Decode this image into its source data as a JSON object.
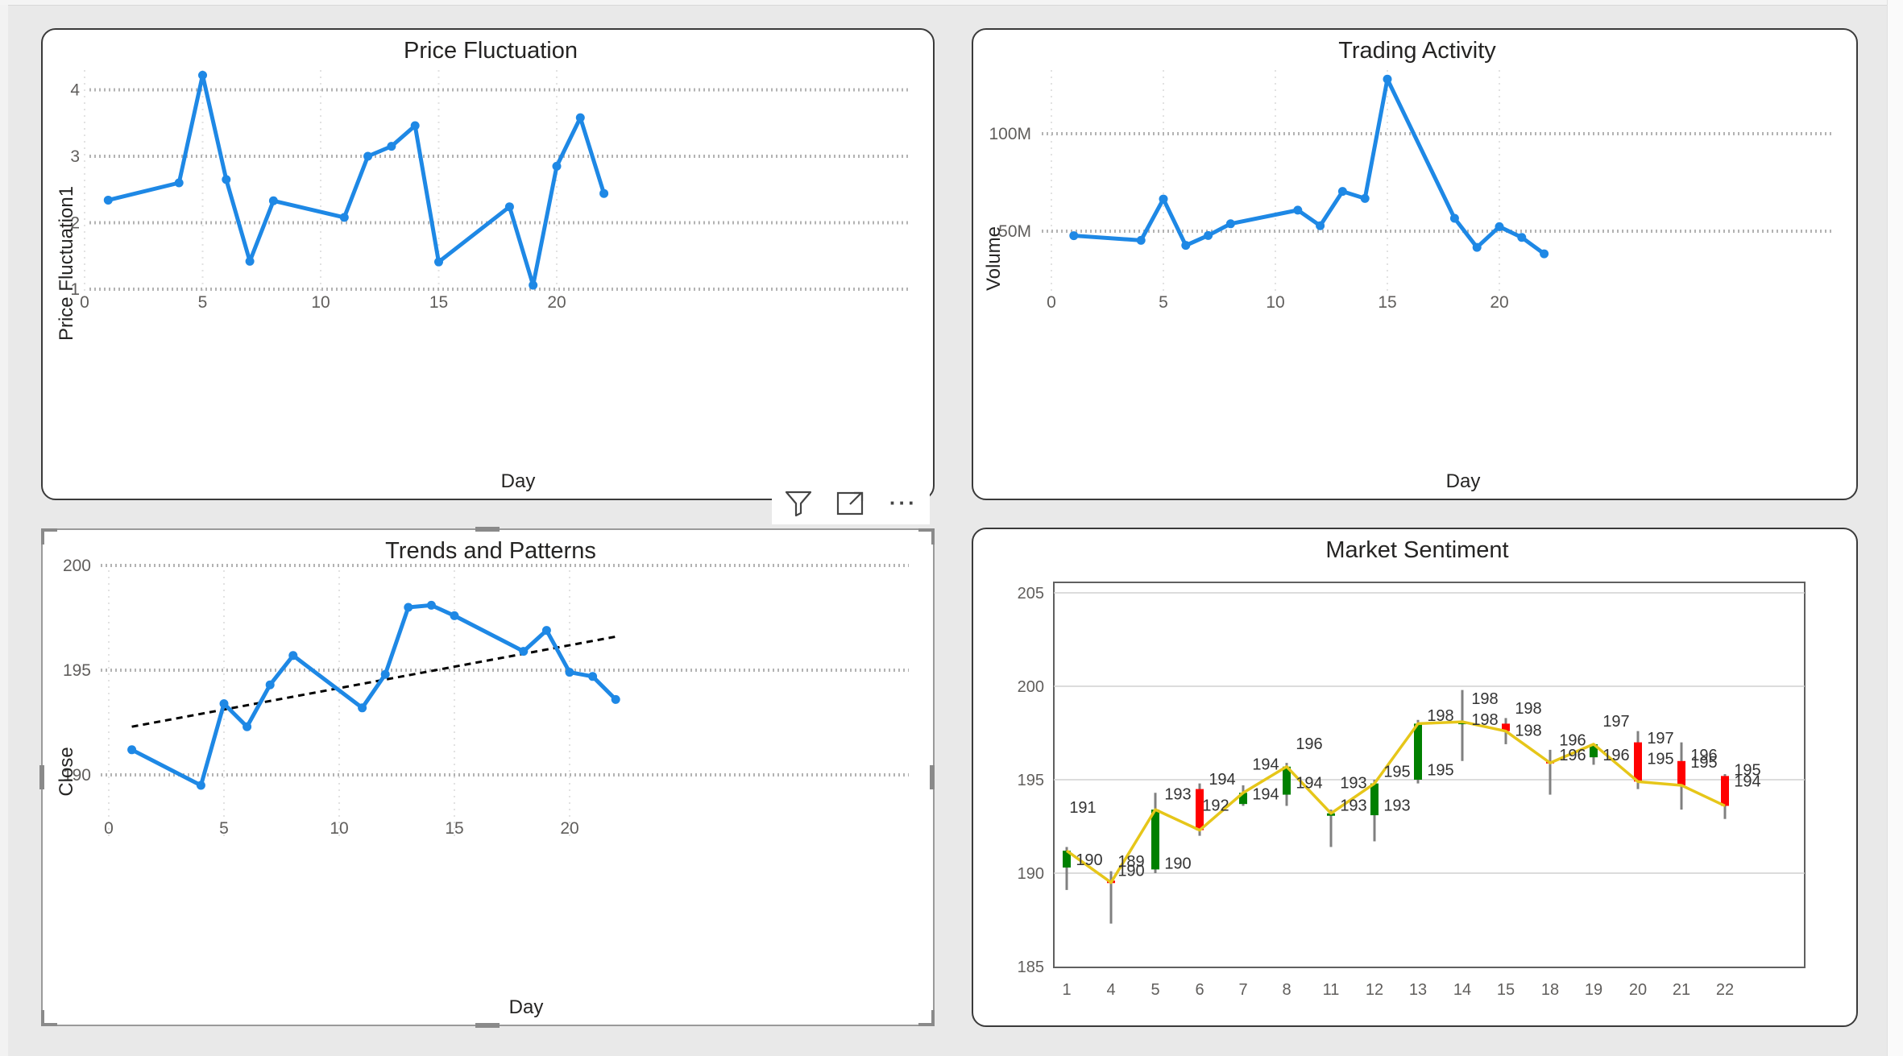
{
  "toolbar": {
    "filter_icon": "filter-icon",
    "focus_icon": "focus-mode-icon",
    "more_icon": "more-options-icon",
    "more_label": "···"
  },
  "colors": {
    "line": "#1e88e5",
    "trend": "#000000",
    "bull": "#008000",
    "bear": "#ff0000",
    "close_line": "#e6c619",
    "wick": "#808080"
  },
  "chart_data": [
    {
      "type": "line",
      "title": "Price Fluctuation",
      "xlabel": "Day",
      "ylabel": "Price Fluctuation1",
      "xlim": [
        0,
        22.3
      ],
      "ylim": [
        1,
        4.6
      ],
      "xticks": [
        "0",
        "5",
        "10",
        "15",
        "20"
      ],
      "yticks": [
        "1",
        "2",
        "3",
        "4"
      ],
      "x": [
        1,
        4,
        5,
        6,
        7,
        8,
        11,
        12,
        13,
        14,
        15,
        18,
        19,
        20,
        21,
        22
      ],
      "y": [
        2.34,
        2.6,
        4.22,
        2.65,
        1.42,
        2.33,
        2.08,
        3.0,
        3.15,
        3.46,
        1.41,
        2.24,
        1.06,
        2.85,
        3.58,
        2.44
      ],
      "grid": true
    },
    {
      "type": "line",
      "title": "Trading Activity",
      "xlabel": "Day",
      "ylabel": "Volume",
      "xlim": [
        0,
        22.3
      ],
      "ylim": [
        30000000,
        142000000
      ],
      "xticks": [
        "0",
        "5",
        "10",
        "15",
        "20"
      ],
      "yticks": [
        "50M",
        "100M"
      ],
      "x": [
        1,
        4,
        5,
        6,
        7,
        8,
        11,
        12,
        13,
        14,
        15,
        18,
        19,
        20,
        21,
        22
      ],
      "y": [
        47700000,
        45300000,
        66500000,
        42700000,
        47800000,
        53800000,
        60800000,
        52800000,
        70400000,
        66800000,
        128000000,
        56600000,
        41700000,
        52300000,
        46800000,
        38400000
      ],
      "grid": true
    },
    {
      "type": "line",
      "title": "Trends and Patterns",
      "xlabel": "Day",
      "ylabel": "Close",
      "xlim": [
        0,
        22.3
      ],
      "ylim": [
        188,
        200
      ],
      "xticks": [
        "0",
        "5",
        "10",
        "15",
        "20"
      ],
      "yticks": [
        "190",
        "195",
        "200"
      ],
      "x": [
        1,
        4,
        5,
        6,
        7,
        8,
        11,
        12,
        13,
        14,
        15,
        18,
        19,
        20,
        21,
        22
      ],
      "y": [
        191.2,
        189.5,
        193.4,
        192.3,
        194.3,
        195.7,
        193.2,
        194.8,
        198.0,
        198.1,
        197.6,
        195.9,
        196.9,
        194.9,
        194.7,
        193.6
      ],
      "trendline": {
        "x": [
          1,
          22
        ],
        "y": [
          192.3,
          196.6
        ],
        "style": "dashed"
      },
      "grid": true
    },
    {
      "type": "candlestick",
      "title": "Market Sentiment",
      "ylim": [
        185,
        205
      ],
      "yticks": [
        "185",
        "190",
        "195",
        "200",
        "205"
      ],
      "categories": [
        "1",
        "4",
        "5",
        "6",
        "7",
        "8",
        "11",
        "12",
        "13",
        "14",
        "15",
        "18",
        "19",
        "20",
        "21",
        "22"
      ],
      "open": [
        190.3,
        189.6,
        190.2,
        194.5,
        193.7,
        194.2,
        193.2,
        193.1,
        195.0,
        198.0,
        198.0,
        196.0,
        196.2,
        197.0,
        196.0,
        195.2
      ],
      "high": [
        191.4,
        190.1,
        194.3,
        194.8,
        194.7,
        195.9,
        193.4,
        195.0,
        198.2,
        199.8,
        198.3,
        196.6,
        196.9,
        197.6,
        197.0,
        195.3
      ],
      "low": [
        189.1,
        187.3,
        190.0,
        192.0,
        193.6,
        193.6,
        191.4,
        191.7,
        194.8,
        196.0,
        196.9,
        194.2,
        195.8,
        194.5,
        193.4,
        192.9
      ],
      "close": [
        191.2,
        189.5,
        193.4,
        192.3,
        194.3,
        195.7,
        193.2,
        194.8,
        198.0,
        198.1,
        197.6,
        195.9,
        196.9,
        194.9,
        194.7,
        193.6
      ],
      "close_line": true,
      "labels": [
        {
          "i": 0,
          "text": "191",
          "y": 193.5,
          "dx": 20
        },
        {
          "i": 0,
          "text": "190",
          "y": 190.7,
          "dx": 28
        },
        {
          "i": 1,
          "text": "189",
          "y": 190.6,
          "dx": 25
        },
        {
          "i": 1,
          "text": "190",
          "y": 190.1,
          "dx": 25
        },
        {
          "i": 2,
          "text": "193",
          "y": 194.2,
          "dx": 28
        },
        {
          "i": 2,
          "text": "190",
          "y": 190.5,
          "dx": 28
        },
        {
          "i": 3,
          "text": "194",
          "y": 195.0,
          "dx": 28
        },
        {
          "i": 3,
          "text": "192",
          "y": 193.6,
          "dx": 20
        },
        {
          "i": 4,
          "text": "194",
          "y": 195.8,
          "dx": 28
        },
        {
          "i": 4,
          "text": "194",
          "y": 194.2,
          "dx": 28
        },
        {
          "i": 5,
          "text": "196",
          "y": 196.9,
          "dx": 28
        },
        {
          "i": 5,
          "text": "194",
          "y": 194.8,
          "dx": 28
        },
        {
          "i": 6,
          "text": "193",
          "y": 194.8,
          "dx": 28
        },
        {
          "i": 6,
          "text": "193",
          "y": 193.6,
          "dx": 28
        },
        {
          "i": 7,
          "text": "195",
          "y": 195.4,
          "dx": 28
        },
        {
          "i": 7,
          "text": "193",
          "y": 193.6,
          "dx": 28
        },
        {
          "i": 8,
          "text": "198",
          "y": 198.4,
          "dx": 28
        },
        {
          "i": 8,
          "text": "195",
          "y": 195.5,
          "dx": 28
        },
        {
          "i": 9,
          "text": "198",
          "y": 199.3,
          "dx": 28
        },
        {
          "i": 9,
          "text": "198",
          "y": 198.2,
          "dx": 28
        },
        {
          "i": 10,
          "text": "198",
          "y": 198.8,
          "dx": 28
        },
        {
          "i": 10,
          "text": "198",
          "y": 197.6,
          "dx": 28
        },
        {
          "i": 11,
          "text": "196",
          "y": 197.1,
          "dx": 28
        },
        {
          "i": 11,
          "text": "196",
          "y": 196.3,
          "dx": 28
        },
        {
          "i": 12,
          "text": "197",
          "y": 198.1,
          "dx": 28
        },
        {
          "i": 12,
          "text": "196",
          "y": 196.3,
          "dx": 28
        },
        {
          "i": 13,
          "text": "197",
          "y": 197.2,
          "dx": 28
        },
        {
          "i": 13,
          "text": "195",
          "y": 196.1,
          "dx": 28
        },
        {
          "i": 14,
          "text": "196",
          "y": 196.3,
          "dx": 28
        },
        {
          "i": 14,
          "text": "195",
          "y": 195.9,
          "dx": 28
        },
        {
          "i": 15,
          "text": "195",
          "y": 195.5,
          "dx": 28
        },
        {
          "i": 15,
          "text": "194",
          "y": 194.9,
          "dx": 28
        }
      ]
    }
  ]
}
